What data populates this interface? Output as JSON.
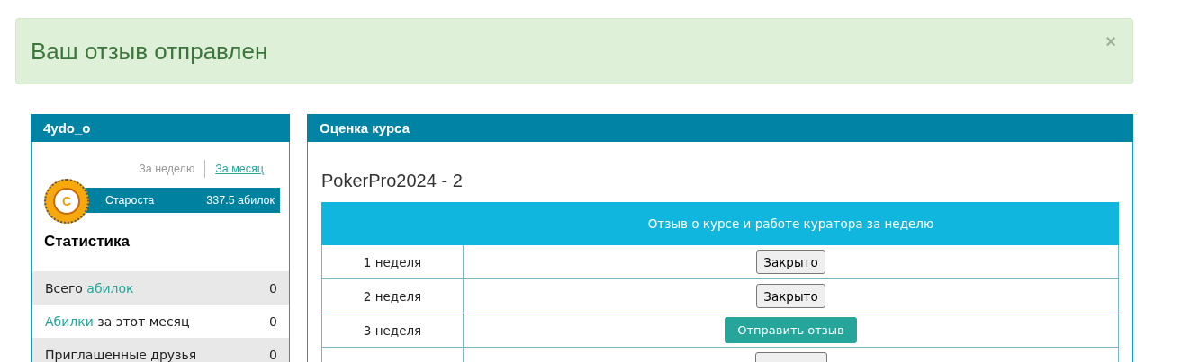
{
  "alert": {
    "message": "Ваш отзыв отправлен",
    "close": "×"
  },
  "profile": {
    "title": "4ydo_o",
    "periods": [
      {
        "label": "За неделю",
        "selected": false
      },
      {
        "label": "За месяц",
        "selected": true
      }
    ],
    "badge": {
      "letter": "С",
      "rank": "Староста",
      "points": "337.5 абилок"
    },
    "stats_title": "Статистика",
    "stats": [
      {
        "parts": [
          {
            "text": "Всего ",
            "link": false
          },
          {
            "text": "абилок",
            "link": true
          }
        ],
        "value": "0"
      },
      {
        "parts": [
          {
            "text": "Абилки",
            "link": true
          },
          {
            "text": " за этот месяц",
            "link": false
          }
        ],
        "value": "0"
      },
      {
        "parts": [
          {
            "text": "Приглашенные друзья",
            "link": false
          }
        ],
        "value": "0"
      }
    ]
  },
  "course": {
    "title": "Оценка курса",
    "name": "PokerPro2024 - 2",
    "table": {
      "columns": [
        "Отзыв о курсе и работе куратора за неделю"
      ],
      "rows": [
        {
          "week": "1 неделя",
          "button": {
            "kind": "closed",
            "label": "Закрыто"
          }
        },
        {
          "week": "2 неделя",
          "button": {
            "kind": "closed",
            "label": "Закрыто"
          }
        },
        {
          "week": "3 неделя",
          "button": {
            "kind": "send",
            "label": "Отправить отзыв"
          }
        },
        {
          "button": {
            "kind": "closed"
          }
        }
      ]
    }
  }
}
